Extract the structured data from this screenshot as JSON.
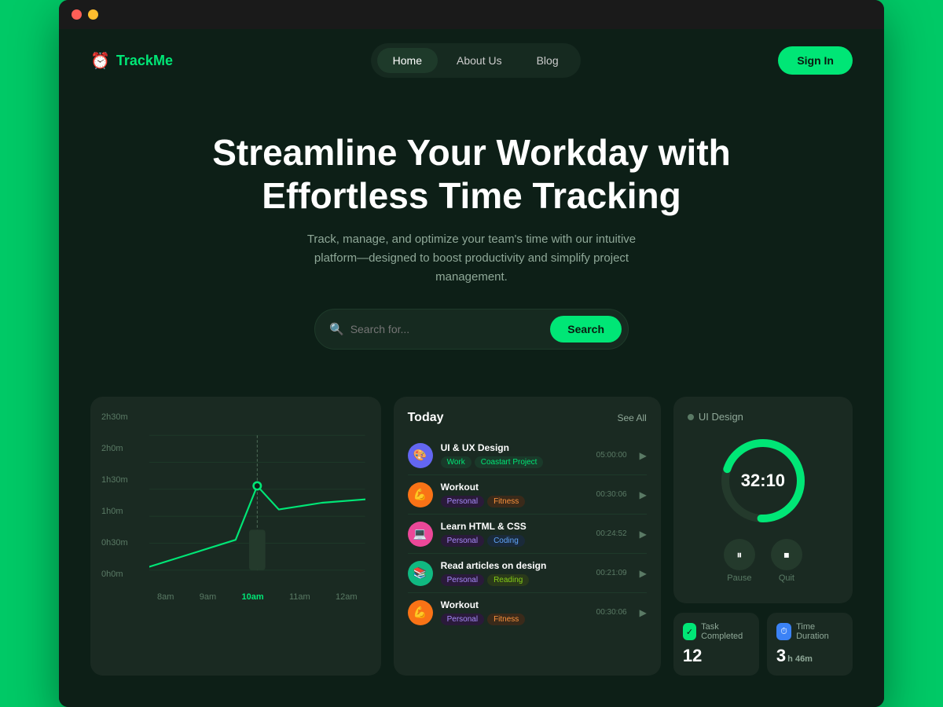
{
  "browser": {
    "dots": [
      "red",
      "yellow",
      "green"
    ]
  },
  "nav": {
    "logo_icon": "⏰",
    "logo_text": "TrackMe",
    "links": [
      {
        "label": "Home",
        "active": true
      },
      {
        "label": "About Us",
        "active": false
      },
      {
        "label": "Blog",
        "active": false
      }
    ],
    "signin_label": "Sign In"
  },
  "hero": {
    "heading_line1": "Streamline Your Workday with",
    "heading_line2": "Effortless Time Tracking",
    "subtext": "Track, manage, and optimize your team's time with our intuitive platform—designed to boost productivity and simplify project management.",
    "search_placeholder": "Search for...",
    "search_button": "Search"
  },
  "chart": {
    "y_labels": [
      "2h30m",
      "2h0m",
      "1h30m",
      "1h0m",
      "0h30m",
      "0h0m"
    ],
    "x_labels": [
      "8am",
      "9am",
      "10am",
      "11am",
      "12am"
    ],
    "active_x": "10am"
  },
  "today": {
    "title": "Today",
    "see_all": "See All",
    "tasks": [
      {
        "name": "UI & UX Design",
        "time": "05:00:00",
        "tags": [
          "Work",
          "Coastart Project"
        ],
        "icon_bg": "#6366f1",
        "icon": "🎨"
      },
      {
        "name": "Workout",
        "time": "00:30:06",
        "tags": [
          "Personal",
          "Fitness"
        ],
        "icon_bg": "#f97316",
        "icon": "💪"
      },
      {
        "name": "Learn HTML & CSS",
        "time": "00:24:52",
        "tags": [
          "Personal",
          "Coding"
        ],
        "icon_bg": "#ec4899",
        "icon": "💻"
      },
      {
        "name": "Read articles on design",
        "time": "00:21:09",
        "tags": [
          "Personal",
          "Reading"
        ],
        "icon_bg": "#10b981",
        "icon": "📚"
      },
      {
        "name": "Workout",
        "time": "00:30:06",
        "tags": [
          "Personal",
          "Fitness"
        ],
        "icon_bg": "#f97316",
        "icon": "💪"
      }
    ]
  },
  "timer": {
    "title": "UI Design",
    "time": "32:10",
    "pause_label": "Pause",
    "quit_label": "Quit",
    "progress_pct": 70
  },
  "stats": [
    {
      "icon": "✓",
      "icon_type": "green",
      "title": "Task Completed",
      "value": "12",
      "unit": ""
    },
    {
      "icon": "⏱",
      "icon_type": "blue",
      "title": "Time Duration",
      "value": "3",
      "unit": "h 46m"
    }
  ]
}
